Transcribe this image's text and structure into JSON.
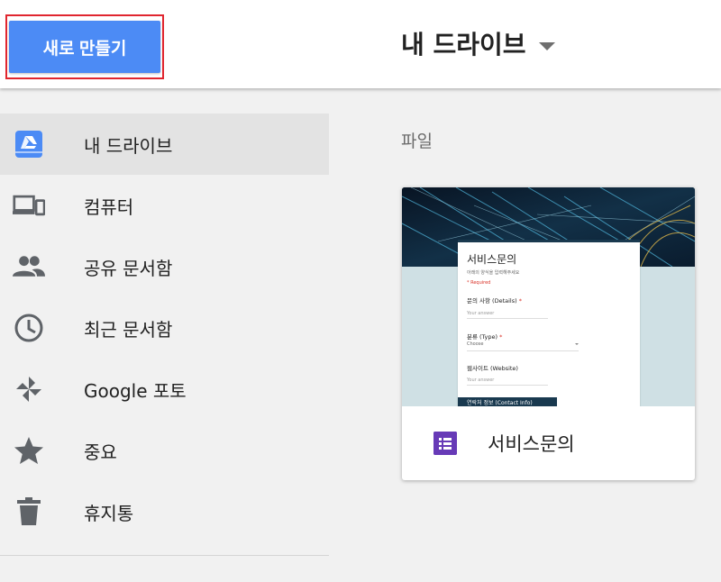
{
  "header": {
    "new_button_label": "새로 만들기",
    "title": "내 드라이브"
  },
  "sidebar": {
    "items": [
      {
        "label": "내 드라이브",
        "icon": "drive-icon",
        "active": true
      },
      {
        "label": "컴퓨터",
        "icon": "computer-icon",
        "active": false
      },
      {
        "label": "공유 문서함",
        "icon": "shared-people-icon",
        "active": false
      },
      {
        "label": "최근 문서함",
        "icon": "clock-icon",
        "active": false
      },
      {
        "label": "Google 포토",
        "icon": "photos-pinwheel-icon",
        "active": false
      },
      {
        "label": "중요",
        "icon": "star-icon",
        "active": false
      },
      {
        "label": "휴지통",
        "icon": "trash-icon",
        "active": false
      }
    ]
  },
  "main": {
    "section_title": "파일",
    "files": [
      {
        "name": "서비스문의",
        "type_icon": "forms-icon",
        "preview": {
          "title": "서비스문의",
          "description": "아래의 양식을 입력해주세요",
          "required_note": "* Required",
          "questions": [
            {
              "label": "문의 사항 (Details)",
              "required": true,
              "answer": "Your answer"
            },
            {
              "label": "분류 (Type)",
              "required": true,
              "answer": "Choose"
            },
            {
              "label": "웹사이트 (Website)",
              "required": false,
              "answer": "Your answer"
            }
          ],
          "section_label": "연락처 정보 (Contact Info)"
        }
      }
    ]
  },
  "colors": {
    "accent": "#4c8bf5",
    "highlight_border": "#e0262f",
    "forms_purple": "#673ab7",
    "sidebar_active_bg": "#e3e3e3",
    "icon_gray": "#5f6368"
  }
}
